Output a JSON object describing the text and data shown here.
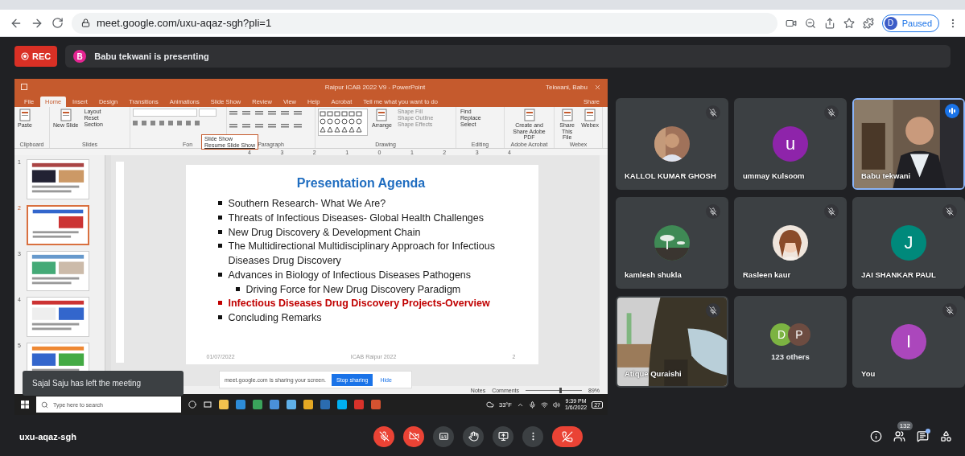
{
  "browser": {
    "url": "meet.google.com/uxu-aqaz-sgh?pli=1",
    "profile": {
      "initial": "D",
      "status": "Paused"
    }
  },
  "meeting_header": {
    "recording": "REC",
    "presenter": {
      "initial": "B",
      "text": "Babu tekwani is presenting"
    }
  },
  "powerpoint": {
    "title": "Raipur ICAB 2022 V9 - PowerPoint",
    "user": "Tekwani, Babu",
    "tabs": [
      {
        "label": "File",
        "selected": false
      },
      {
        "label": "Home",
        "selected": true
      },
      {
        "label": "Insert",
        "selected": false
      },
      {
        "label": "Design",
        "selected": false
      },
      {
        "label": "Transitions",
        "selected": false
      },
      {
        "label": "Animations",
        "selected": false
      },
      {
        "label": "Slide Show",
        "selected": false
      },
      {
        "label": "Review",
        "selected": false
      },
      {
        "label": "View",
        "selected": false
      },
      {
        "label": "Help",
        "selected": false
      },
      {
        "label": "Acrobat",
        "selected": false
      }
    ],
    "tell_me": "Tell me what you want to do",
    "share": "Share",
    "ribbon": [
      {
        "label": "Clipboard",
        "kind": "buttons",
        "buttons": [
          {
            "label": "Paste",
            "kind": "large",
            "disabled": false
          }
        ]
      },
      {
        "label": "Slides",
        "kind": "buttons",
        "buttons": [
          {
            "label": "New Slide",
            "kind": "large",
            "disabled": false
          },
          {
            "label": "Layout",
            "kind": "small",
            "disabled": false
          },
          {
            "label": "Reset",
            "kind": "small",
            "disabled": false
          },
          {
            "label": "Section",
            "kind": "small",
            "disabled": false
          }
        ]
      },
      {
        "label": "Fon",
        "kind": "font"
      },
      {
        "label": "Paragraph",
        "kind": "paragraph"
      },
      {
        "label": "Drawing",
        "kind": "drawing",
        "buttons": [
          {
            "label": "Arrange",
            "kind": "large",
            "disabled": false
          },
          {
            "label": "Shape Fill",
            "kind": "small",
            "disabled": true
          },
          {
            "label": "Shape Outline",
            "kind": "small",
            "disabled": true
          },
          {
            "label": "Shape Effects",
            "kind": "small",
            "disabled": true
          }
        ]
      },
      {
        "label": "Editing",
        "kind": "buttons",
        "buttons": [
          {
            "label": "Find",
            "kind": "small",
            "disabled": false
          },
          {
            "label": "Replace",
            "kind": "small",
            "disabled": false
          },
          {
            "label": "Select",
            "kind": "small",
            "disabled": false
          }
        ]
      },
      {
        "label": "Adobe Acrobat",
        "kind": "buttons",
        "buttons": [
          {
            "label": "Create and Share Adobe PDF",
            "kind": "large",
            "disabled": false
          }
        ]
      },
      {
        "label": "Webex",
        "kind": "buttons",
        "buttons": [
          {
            "label": "Share This File",
            "kind": "large",
            "disabled": false
          },
          {
            "label": "Webex",
            "kind": "large",
            "disabled": false
          }
        ]
      }
    ],
    "slide_show_popup": {
      "title": "Slide Show",
      "action": "Resume Slide Show"
    },
    "ruler": [
      "4",
      "3",
      "2",
      "1",
      "0",
      "1",
      "2",
      "3",
      "4"
    ],
    "thumbnails": [
      {
        "number": "1",
        "selected": false
      },
      {
        "number": "2",
        "selected": true
      },
      {
        "number": "3",
        "selected": false
      },
      {
        "number": "4",
        "selected": false
      },
      {
        "number": "5",
        "selected": false
      }
    ],
    "slide": {
      "title": "Presentation Agenda",
      "bullets": [
        {
          "text": "Southern Research- What We Are?",
          "highlighted": false
        },
        {
          "text": "Threats of Infectious Diseases- Global Health Challenges",
          "highlighted": false
        },
        {
          "text": "New Drug Discovery & Development Chain",
          "highlighted": false
        },
        {
          "text": "The Multidirectional Multidisciplinary Approach for Infectious Diseases Drug Discovery",
          "highlighted": false
        },
        {
          "text": "Advances in Biology of Infectious Diseases Pathogens",
          "highlighted": false,
          "children": [
            {
              "text": "Driving Force for New Drug Discovery Paradigm",
              "highlighted": false
            }
          ]
        },
        {
          "text": "Infectious Diseases Drug Discovery Projects-Overview",
          "highlighted": true
        },
        {
          "text": "Concluding Remarks",
          "highlighted": false
        }
      ],
      "footer": {
        "date": "01/07/2022",
        "event": "ICAB Raipur 2022",
        "page": "2"
      }
    },
    "status_bar": {
      "notes": "Notes",
      "comments": "Comments",
      "zoom": "89%",
      "level": 0.6
    },
    "sharing_bar": {
      "message": "meet.google.com is sharing your screen.",
      "stop": "Stop sharing",
      "hide": "Hide"
    },
    "taskbar": {
      "search_placeholder": "Type here to search",
      "weather": "33°F",
      "time": "9:39 PM",
      "date": "1/6/2022",
      "notifications": "27"
    }
  },
  "toast": "Sajal Saju has left the meeting",
  "participants": [
    {
      "name": "KALLOL KUMAR GHOSH",
      "muted": true,
      "speaking": false
    },
    {
      "name": "ummay Kulsoom",
      "kind": "letter",
      "initial": "u",
      "color": "#8e24aa",
      "muted": true,
      "speaking": false
    },
    {
      "name": "Babu tekwani",
      "kind": "video",
      "muted": false,
      "speaking": true
    },
    {
      "name": "kamlesh shukla",
      "muted": true,
      "speaking": false
    },
    {
      "name": "Rasleen kaur",
      "muted": true,
      "speaking": false
    },
    {
      "name": "JAI SHANKAR PAUL",
      "kind": "letter",
      "initial": "J",
      "color": "#00897b",
      "muted": true,
      "speaking": false
    },
    {
      "name": "Atique Quraishi",
      "kind": "video",
      "muted": true,
      "speaking": false
    },
    {
      "name": "123 others",
      "kind": "others",
      "avatars": [
        {
          "initial": "D",
          "color": "#7cb342"
        },
        {
          "initial": "P",
          "color": "#6d4c41"
        }
      ],
      "muted": false,
      "speaking": false
    },
    {
      "name": "You",
      "kind": "letter",
      "initial": "I",
      "color": "#ab47bc",
      "muted": true,
      "speaking": false
    }
  ],
  "bottom_bar": {
    "meeting_code": "uxu-aqaz-sgh",
    "controls": [
      {
        "kind": "mic",
        "on": false
      },
      {
        "kind": "camera",
        "on": false
      },
      {
        "kind": "captions",
        "on": false
      },
      {
        "kind": "hand"
      },
      {
        "kind": "present"
      },
      {
        "kind": "more"
      },
      {
        "kind": "leave"
      }
    ],
    "people_count": "132",
    "chat_unread": true
  }
}
